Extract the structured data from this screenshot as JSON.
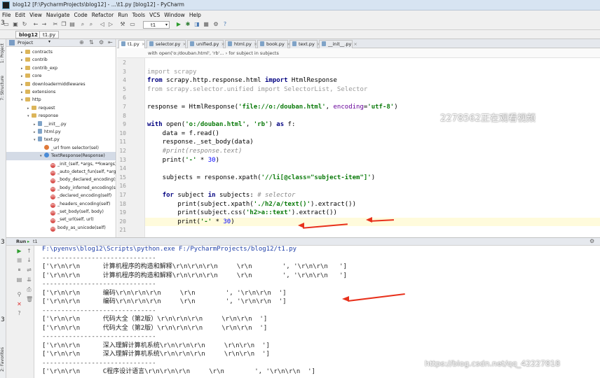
{
  "window": {
    "title": "blog12 [F:\\PycharmProjects\\blog12] - ...\\t1.py [blog12] - PyCharm"
  },
  "menu": [
    "File",
    "Edit",
    "View",
    "Navigate",
    "Code",
    "Refactor",
    "Run",
    "Tools",
    "VCS",
    "Window",
    "Help"
  ],
  "toolbar": {
    "run_config": "t1"
  },
  "nav": {
    "project": "blog12",
    "file": "t1.py"
  },
  "side_labels": {
    "project": "1: Project",
    "structure": "7: Structure",
    "favorites": "2: Favorites",
    "marker": "3"
  },
  "project_panel": {
    "header": "Project",
    "tree": [
      {
        "label": "contracts",
        "icon": "folder-icon",
        "indent": 1,
        "expander": "▸"
      },
      {
        "label": "contrib",
        "icon": "folder-icon",
        "indent": 1,
        "expander": "▸"
      },
      {
        "label": "contrib_exp",
        "icon": "folder-icon",
        "indent": 1,
        "expander": "▸"
      },
      {
        "label": "core",
        "icon": "folder-icon",
        "indent": 1,
        "expander": "▸"
      },
      {
        "label": "downloadermiddlewares",
        "icon": "folder-icon",
        "indent": 1,
        "expander": "▸"
      },
      {
        "label": "extensions",
        "icon": "folder-icon",
        "indent": 1,
        "expander": "▸"
      },
      {
        "label": "http",
        "icon": "folder-icon",
        "indent": 1,
        "expander": "▾"
      },
      {
        "label": "request",
        "icon": "folder-icon",
        "indent": 2,
        "expander": "▸"
      },
      {
        "label": "response",
        "icon": "folder-icon",
        "indent": 2,
        "expander": "▾"
      },
      {
        "label": "__init__.py",
        "icon": "python-file-icon",
        "indent": 3,
        "expander": "▸"
      },
      {
        "label": "html.py",
        "icon": "python-file-icon",
        "indent": 3,
        "expander": "▸"
      },
      {
        "label": "text.py",
        "icon": "python-file-icon",
        "indent": 3,
        "expander": "▾"
      },
      {
        "label": "_url from selector(sel)",
        "icon": "function-icon",
        "indent": 4,
        "expander": ""
      },
      {
        "label": "TextResponse(Response)",
        "icon": "class-icon",
        "indent": 4,
        "expander": "▾",
        "selected": true
      },
      {
        "label": "_init_(self, *args, **kwargs)",
        "icon": "method-icon",
        "indent": 5,
        "expander": ""
      },
      {
        "label": "_auto_detect_fun(self, *args)",
        "icon": "method-icon",
        "indent": 5,
        "expander": ""
      },
      {
        "label": "_body_declared_encoding(self)",
        "icon": "method-icon",
        "indent": 5,
        "expander": ""
      },
      {
        "label": "_body_inferred_encoding(self)",
        "icon": "method-icon",
        "indent": 5,
        "expander": ""
      },
      {
        "label": "_declared_encoding(self)",
        "icon": "method-icon",
        "indent": 5,
        "expander": ""
      },
      {
        "label": "_headers_encoding(self)",
        "icon": "method-icon",
        "indent": 5,
        "expander": ""
      },
      {
        "label": "_set_body(self, body)",
        "icon": "method-icon",
        "indent": 5,
        "expander": ""
      },
      {
        "label": "_set_url(self, url)",
        "icon": "method-icon",
        "indent": 5,
        "expander": ""
      },
      {
        "label": "body_as_unicode(self)",
        "icon": "method-icon",
        "indent": 5,
        "expander": ""
      }
    ]
  },
  "editor": {
    "tabs": [
      {
        "label": "t1.py",
        "active": true
      },
      {
        "label": "selector.py",
        "active": false
      },
      {
        "label": "unified.py",
        "active": false
      },
      {
        "label": "html.py",
        "active": false
      },
      {
        "label": "book.py",
        "active": false
      },
      {
        "label": "text.py",
        "active": false
      },
      {
        "label": "__init__.py",
        "active": false
      }
    ],
    "breadcrumb": "with open('o:/douban.html', 'rb'...   ›   for subject in subjects",
    "line_numbers": [
      "2",
      "3",
      "4",
      "5",
      "6",
      "7",
      "8",
      "9",
      "10",
      "11",
      "12",
      "13",
      "14",
      "15",
      "16",
      "17",
      "18",
      "19",
      "20",
      "21"
    ],
    "lines": [
      "",
      "<span class='kg'>import</span> <span class='kg'>scrapy</span>",
      "<span class='k'>from</span> scrapy.http.response.html <span class='k'>import</span> HtmlResponse",
      "<span class='kg'>from scrapy.selector.unified</span> <span class='kg'>import</span> <span class='kg'>SelectorList, Selector</span>",
      "",
      "response = HtmlResponse(<span class='s'>'file://o:/douban.html'</span>, <span class='pm'>encoding</span>=<span class='s'>'utf-8'</span>)",
      "",
      "<span class='k'>with</span> open(<span class='s'>'o:/douban.html'</span>, <span class='s'>'rb'</span>) <span class='k'>as</span> f:",
      "    data = f.read()",
      "    response._set_body(data)",
      "    <span class='cm'>#print(response.text)</span>",
      "    print(<span class='s'>'-'</span> * <span class='n'>30</span>)",
      "",
      "    subjects = response.xpath(<span class='s'>'//li[@class=\"subject-item\"]'</span>)",
      "",
      "    <span class='k'>for</span> subject <span class='k'>in</span> subjects: <span class='cm'># selector</span>",
      "        print(subject.xpath(<span class='s'>'./h2/a/text()'</span>).extract())",
      "        print(subject.css(<span class='s'>'h2>a::text'</span>).extract())",
      "        print(<span class='s'>'-'</span> * <span class='n'>30</span>)",
      ""
    ],
    "current_line_index": 18
  },
  "overlay": {
    "viewer_notice": "2278562正在观看视频",
    "blog_watermark": "https://blog.csdn.net/qq_42227818"
  },
  "run_panel": {
    "header": "Run",
    "tab": "t1",
    "output": [
      "F:\\pyenvs\\blog12\\Scripts\\python.exe F:/PycharmProjects/blog12/t1.py",
      "------------------------------",
      "['\\r\\n\\r\\n      计算机程序的构造和解释\\r\\n\\r\\n\\r\\n     \\r\\n        ', '\\r\\n\\r\\n   ']",
      "['\\r\\n\\r\\n      计算机程序的构造和解释\\r\\n\\r\\n\\r\\n     \\r\\n        ', '\\r\\n\\r\\n   ']",
      "------------------------------",
      "['\\r\\n\\r\\n      编码\\r\\n\\r\\n\\r\\n     \\r\\n        ', '\\r\\n\\r\\n  ']",
      "['\\r\\n\\r\\n      编码\\r\\n\\r\\n\\r\\n     \\r\\n        ', '\\r\\n\\r\\n  ']",
      "------------------------------",
      "['\\r\\n\\r\\n      代码大全（第2版）\\r\\n\\r\\n\\r\\n     \\r\\n\\r\\n  ']",
      "['\\r\\n\\r\\n      代码大全（第2版）\\r\\n\\r\\n\\r\\n     \\r\\n\\r\\n  ']",
      "------------------------------",
      "['\\r\\n\\r\\n      深入理解计算机系统\\r\\n\\r\\n\\r\\n     \\r\\n\\r\\n  ']",
      "['\\r\\n\\r\\n      深入理解计算机系统\\r\\n\\r\\n\\r\\n     \\r\\n\\r\\n  ']",
      "------------------------------",
      "['\\r\\n\\r\\n      C程序设计语言\\r\\n\\r\\n\\r\\n     \\r\\n        ', '\\r\\n\\r\\n  ']"
    ]
  },
  "colors": {
    "annotation_arrow": "#e8311c",
    "selection": "#d4dbe6",
    "current_line": "#fffbdc",
    "keyword": "#000080",
    "string": "#0a7a0a"
  }
}
